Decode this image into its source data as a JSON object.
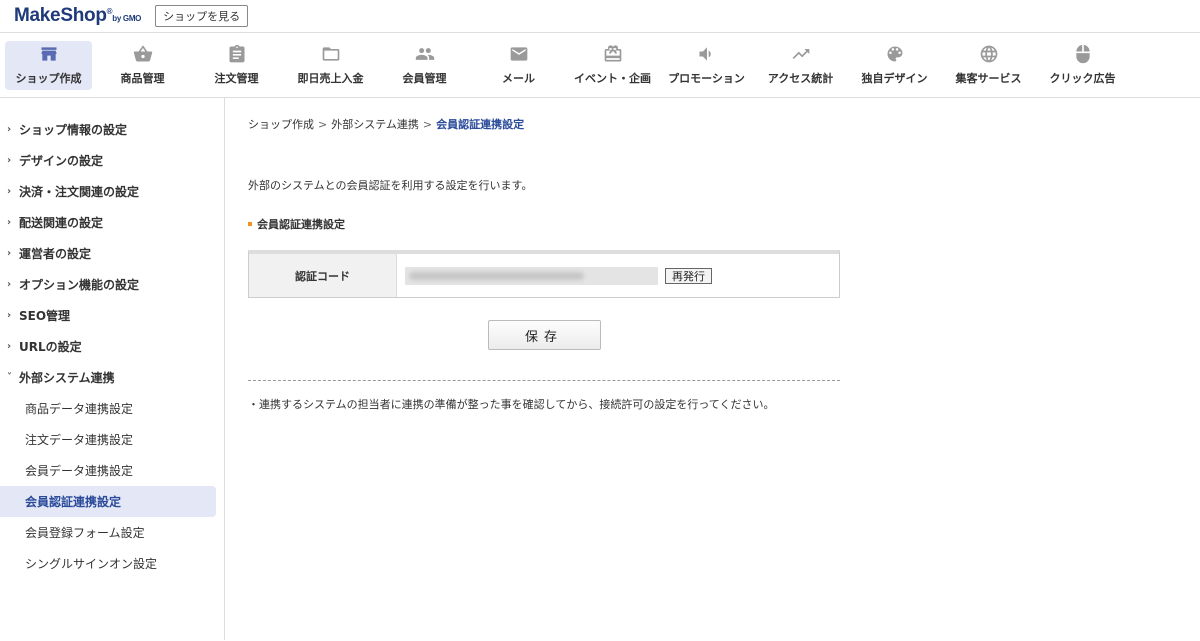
{
  "header": {
    "logo_main": "MakeShop",
    "logo_reg": "®",
    "logo_sub": "by GMO",
    "view_shop_label": "ショップを見る"
  },
  "nav": [
    {
      "label": "ショップ作成",
      "icon": "store-icon",
      "active": true
    },
    {
      "label": "商品管理",
      "icon": "basket-icon"
    },
    {
      "label": "注文管理",
      "icon": "clipboard-icon"
    },
    {
      "label": "即日売上入金",
      "icon": "folder-icon"
    },
    {
      "label": "会員管理",
      "icon": "people-icon"
    },
    {
      "label": "メール",
      "icon": "mail-icon"
    },
    {
      "label": "イベント・企画",
      "icon": "gift-icon"
    },
    {
      "label": "プロモーション",
      "icon": "speaker-icon"
    },
    {
      "label": "アクセス統計",
      "icon": "trend-icon"
    },
    {
      "label": "独自デザイン",
      "icon": "palette-icon"
    },
    {
      "label": "集客サービス",
      "icon": "globe-icon"
    },
    {
      "label": "クリック広告",
      "icon": "mouse-icon"
    }
  ],
  "sidebar": {
    "sections": [
      {
        "label": "ショップ情報の設定",
        "chevron": "›"
      },
      {
        "label": "デザインの設定",
        "chevron": "›"
      },
      {
        "label": "決済・注文関連の設定",
        "chevron": "›"
      },
      {
        "label": "配送関連の設定",
        "chevron": "›"
      },
      {
        "label": "運営者の設定",
        "chevron": "›"
      },
      {
        "label": "オプション機能の設定",
        "chevron": "›"
      },
      {
        "label": "SEO管理",
        "chevron": "›"
      },
      {
        "label": "URLの設定",
        "chevron": "›"
      },
      {
        "label": "外部システム連携",
        "chevron": "˅"
      }
    ],
    "sub_items": [
      {
        "label": "商品データ連携設定"
      },
      {
        "label": "注文データ連携設定"
      },
      {
        "label": "会員データ連携設定"
      },
      {
        "label": "会員認証連携設定",
        "active": true
      },
      {
        "label": "会員登録フォーム設定"
      },
      {
        "label": "シングルサインオン設定"
      }
    ]
  },
  "breadcrumb": {
    "items": [
      "ショップ作成",
      "外部システム連携"
    ],
    "current": "会員認証連携設定",
    "separator": ">"
  },
  "main": {
    "description": "外部のシステムとの会員認証を利用する設定を行います。",
    "section_title": "会員認証連携設定",
    "form": {
      "label": "認証コード",
      "reissue_label": "再発行"
    },
    "save_label": "保存",
    "note": "・連携するシステムの担当者に連携の準備が整った事を確認してから、接続許可の設定を行ってください。"
  },
  "colors": {
    "brand": "#1f3a7a",
    "accent": "#2a4a9a",
    "active_bg": "#e4e8f6",
    "section_mark": "#f0921f"
  }
}
